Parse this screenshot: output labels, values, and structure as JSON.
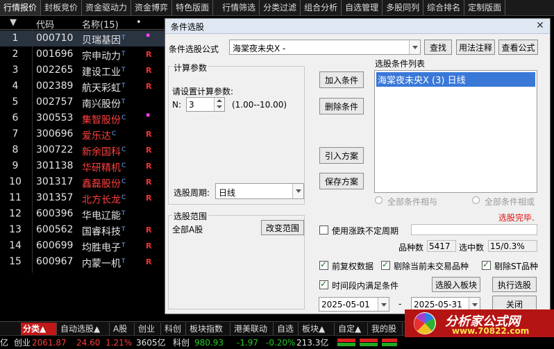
{
  "top_tabs": [
    "行情报价",
    "封板竞价",
    "资金驱动力",
    "资金博弈",
    "特色版面",
    "行情筛选",
    "分类过滤",
    "组合分析",
    "自选管理",
    "多股同列",
    "综合排名",
    "定制版面"
  ],
  "grid": {
    "headers": {
      "code": "代码",
      "name": "名称(15)",
      "dot": "•"
    },
    "rows": [
      {
        "idx": "1",
        "code": "000710",
        "name": "贝瑞基因",
        "sup": "T",
        "red": false,
        "flag": "▪",
        "flag_type": "m"
      },
      {
        "idx": "2",
        "code": "001696",
        "name": "宗申动力",
        "sup": "T",
        "red": false,
        "flag": "R",
        "flag_type": "r"
      },
      {
        "idx": "3",
        "code": "002265",
        "name": "建设工业",
        "sup": "T",
        "red": false,
        "flag": "R",
        "flag_type": "r"
      },
      {
        "idx": "4",
        "code": "002389",
        "name": "航天彩虹",
        "sup": "T",
        "red": false,
        "flag": "R",
        "flag_type": "r"
      },
      {
        "idx": "5",
        "code": "002757",
        "name": "南兴股份",
        "sup": "T",
        "red": false,
        "flag": "",
        "flag_type": "r"
      },
      {
        "idx": "6",
        "code": "300553",
        "name": "集智股份",
        "sup": "C",
        "red": true,
        "flag": "▪",
        "flag_type": "m"
      },
      {
        "idx": "7",
        "code": "300696",
        "name": "爱乐达",
        "sup": "C",
        "red": true,
        "flag": "R",
        "flag_type": "r"
      },
      {
        "idx": "8",
        "code": "300722",
        "name": "新余国科",
        "sup": "C",
        "red": true,
        "flag": "R",
        "flag_type": "r"
      },
      {
        "idx": "9",
        "code": "301138",
        "name": "华研精机",
        "sup": "C",
        "red": true,
        "flag": "R",
        "flag_type": "r"
      },
      {
        "idx": "10",
        "code": "301317",
        "name": "鑫磊股份",
        "sup": "C",
        "red": true,
        "flag": "R",
        "flag_type": "r"
      },
      {
        "idx": "11",
        "code": "301357",
        "name": "北方长龙",
        "sup": "C",
        "red": true,
        "flag": "R",
        "flag_type": "r"
      },
      {
        "idx": "12",
        "code": "600396",
        "name": "华电辽能",
        "sup": "T",
        "red": false,
        "flag": "",
        "flag_type": "r"
      },
      {
        "idx": "13",
        "code": "600562",
        "name": "国睿科技",
        "sup": "T",
        "red": false,
        "flag": "R",
        "flag_type": "r"
      },
      {
        "idx": "14",
        "code": "600699",
        "name": "均胜电子",
        "sup": "T",
        "red": false,
        "flag": "R",
        "flag_type": "r"
      },
      {
        "idx": "15",
        "code": "600967",
        "name": "内蒙一机",
        "sup": "T",
        "red": false,
        "flag": "R",
        "flag_type": "r"
      }
    ]
  },
  "dialog": {
    "title": "条件选股",
    "formula_label": "条件选股公式",
    "formula_value": "海棠夜未央X  -",
    "btn_find": "查找",
    "btn_usage": "用法注释",
    "btn_view": "查看公式",
    "calc_group": "计算参数",
    "calc_prompt": "请设置计算参数:",
    "param_label": "N:",
    "param_value": "3",
    "param_range": "(1.00--10.00)",
    "period_label": "选股周期:",
    "period_value": "日线",
    "btn_add": "加入条件",
    "btn_delete": "删除条件",
    "btn_import": "引入方案",
    "btn_save": "保存方案",
    "cond_list_label": "选股条件列表",
    "cond_items": [
      "海棠夜未央X (3) 日线"
    ],
    "radio_and": "全部条件相与",
    "radio_or": "全部条件相或",
    "status": "选股完毕.",
    "range_group": "选股范围",
    "range_value": "全部A股",
    "btn_change_range": "改变范围",
    "cb_uncertain": "使用涨跌不定周期",
    "count_label": "品种数",
    "count_value": "5417",
    "selected_label": "选中数",
    "selected_value": "15/0.3%",
    "cb_prerestore": "前复权数据",
    "cb_exclude_untraded": "剔除当前未交易品种",
    "cb_exclude_st": "剔除ST品种",
    "cb_time_range": "时间段内满足条件",
    "btn_to_block": "选股入板块",
    "btn_execute": "执行选股",
    "date_from": "2025-05-01",
    "date_sep": "-",
    "date_to": "2025-05-31",
    "btn_close": "关闭"
  },
  "bottom_tabs": [
    "分类▲",
    "自动选股▲",
    "A股",
    "创业",
    "科创",
    "板块指数",
    "港美联动",
    "自选",
    "板块▲",
    "自定▲",
    "我的股"
  ],
  "status": {
    "prefix": "亿",
    "idx1_name": "创业",
    "idx1_value": "2061.87",
    "idx1_change": "24.60",
    "idx1_pct": "1.21%",
    "idx1_amount": "3605亿",
    "idx2_name": "科创",
    "idx2_value": "980.93",
    "idx2_change": "-1.97",
    "idx2_pct": "-0.20%",
    "idx2_amount": "213.3亿"
  },
  "logo": {
    "line1": "分析家公式网",
    "line2": "www.70822.com"
  }
}
